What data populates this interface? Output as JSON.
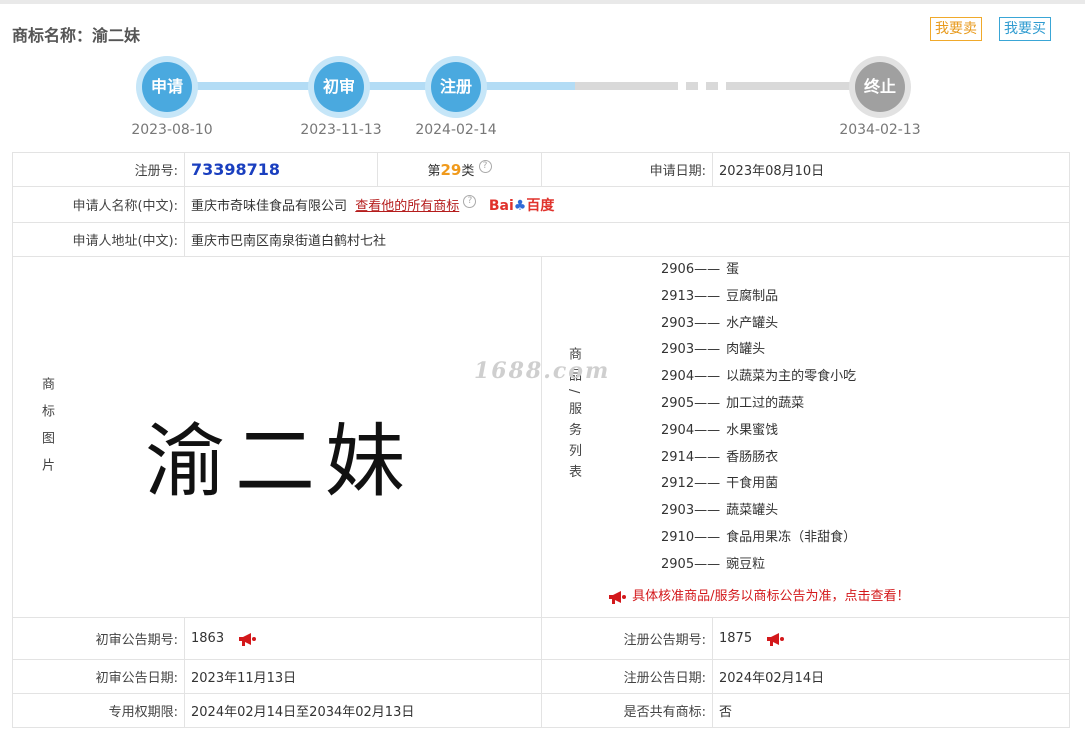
{
  "header": {
    "title": "商标名称：渝二妹",
    "sell_label": "我要卖",
    "buy_label": "我要买"
  },
  "timeline": {
    "steps": [
      {
        "label": "申请",
        "date": "2023-08-10"
      },
      {
        "label": "初审",
        "date": "2023-11-13"
      },
      {
        "label": "注册",
        "date": "2024-02-14"
      },
      {
        "label": "终止",
        "date": "2034-02-13"
      }
    ]
  },
  "info": {
    "reg_no_label": "注册号:",
    "reg_no": "73398718",
    "class_prefix": "第",
    "class_num": "29",
    "class_suffix": "类",
    "apply_date_label": "申请日期:",
    "apply_date": "2023年08月10日",
    "applicant_label": "申请人名称(中文):",
    "applicant": "重庆市奇味佳食品有限公司",
    "applicant_link": "查看他的所有商标",
    "baidu_bai": "Bai",
    "baidu_du": "百度",
    "address_label": "申请人地址(中文):",
    "address": "重庆市巴南区南泉街道白鹤村七社",
    "image_label": "商标图片",
    "mark_text": "渝二妹",
    "goods_label": "商品/服务列表",
    "goods": [
      {
        "code": "2906",
        "name": "蛋"
      },
      {
        "code": "2913",
        "name": "豆腐制品"
      },
      {
        "code": "2903",
        "name": "水产罐头"
      },
      {
        "code": "2903",
        "name": "肉罐头"
      },
      {
        "code": "2904",
        "name": "以蔬菜为主的零食小吃"
      },
      {
        "code": "2905",
        "name": "加工过的蔬菜"
      },
      {
        "code": "2904",
        "name": "水果蜜饯"
      },
      {
        "code": "2914",
        "name": "香肠肠衣"
      },
      {
        "code": "2912",
        "name": "干食用菌"
      },
      {
        "code": "2903",
        "name": "蔬菜罐头"
      },
      {
        "code": "2910",
        "name": "食品用果冻（非甜食）"
      },
      {
        "code": "2905",
        "name": "豌豆粒"
      }
    ],
    "goods_separator": "——",
    "goods_notice": "具体核准商品/服务以商标公告为准，点击查看！",
    "prelim_no_label": "初审公告期号:",
    "prelim_no": "1863",
    "reg_pub_no_label": "注册公告期号:",
    "reg_pub_no": "1875",
    "prelim_date_label": "初审公告日期:",
    "prelim_date": "2023年11月13日",
    "reg_pub_date_label": "注册公告日期:",
    "reg_pub_date": "2024年02月14日",
    "term_label": "专用权期限:",
    "term": "2024年02月14日至2034年02月13日",
    "shared_label": "是否共有商标:",
    "shared": "否"
  },
  "watermark": "1688.com"
}
